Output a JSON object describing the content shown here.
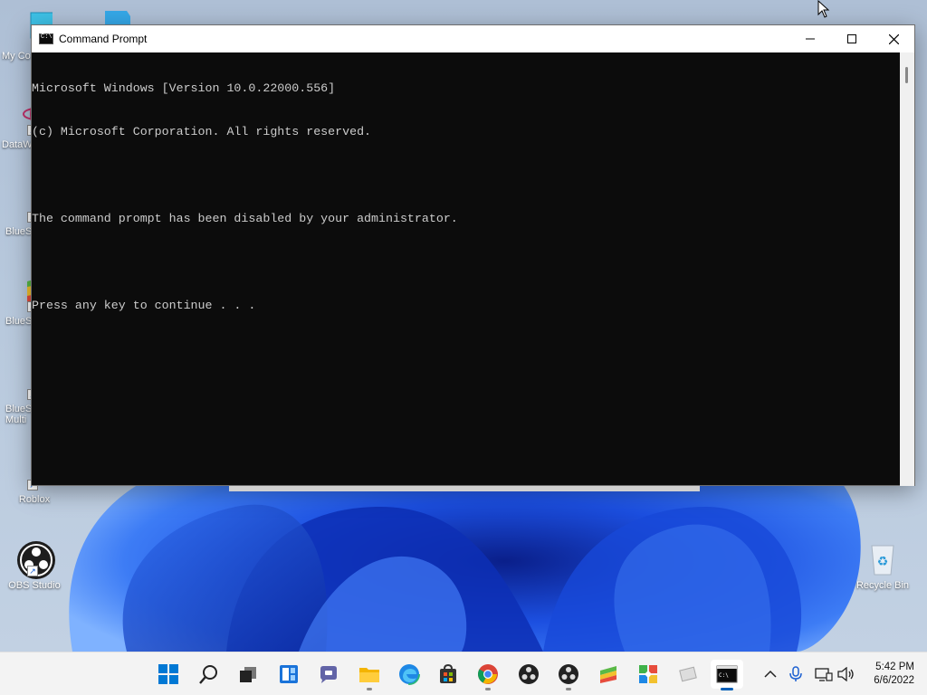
{
  "window": {
    "title": "Command Prompt",
    "console_lines": [
      "Microsoft Windows [Version 10.0.22000.556]",
      "(c) Microsoft Corporation. All rights reserved.",
      "",
      "The command prompt has been disabled by your administrator.",
      "",
      "Press any key to continue . . ."
    ]
  },
  "desktop_icons": [
    {
      "label": "My Co",
      "icon": "monitor-icon"
    },
    {
      "label": "DataW",
      "icon": "atom-icon"
    },
    {
      "label": "BlueS",
      "icon": "bluestacks-icon"
    },
    {
      "label": "BlueS",
      "icon": "bluestacks-icon"
    },
    {
      "label": "BlueS",
      "icon": "bluestacks-multi-icon"
    },
    {
      "label": "Multi",
      "icon": ""
    },
    {
      "label": "Roblox",
      "icon": "roblox-icon"
    },
    {
      "label": "OBS Studio",
      "icon": "obs-icon"
    },
    {
      "label": "Recycle Bin",
      "icon": "recycle-bin-icon"
    }
  ],
  "taskbar": {
    "apps": [
      "start-icon",
      "search-icon",
      "task-view-icon",
      "widgets-icon",
      "teams-chat-icon",
      "file-explorer-icon",
      "edge-icon",
      "store-icon",
      "chrome-icon",
      "obs-icon",
      "obs-icon",
      "bluestacks-icon",
      "bluestacks-multi-icon",
      "roblox-icon",
      "command-prompt-icon"
    ],
    "time": "5:42 PM",
    "date": "6/6/2022"
  },
  "colors": {
    "console_bg": "#0c0c0c",
    "console_text": "#cccccc",
    "accent": "#005fb8",
    "wallpaper_blue": "#1a4fd8"
  }
}
